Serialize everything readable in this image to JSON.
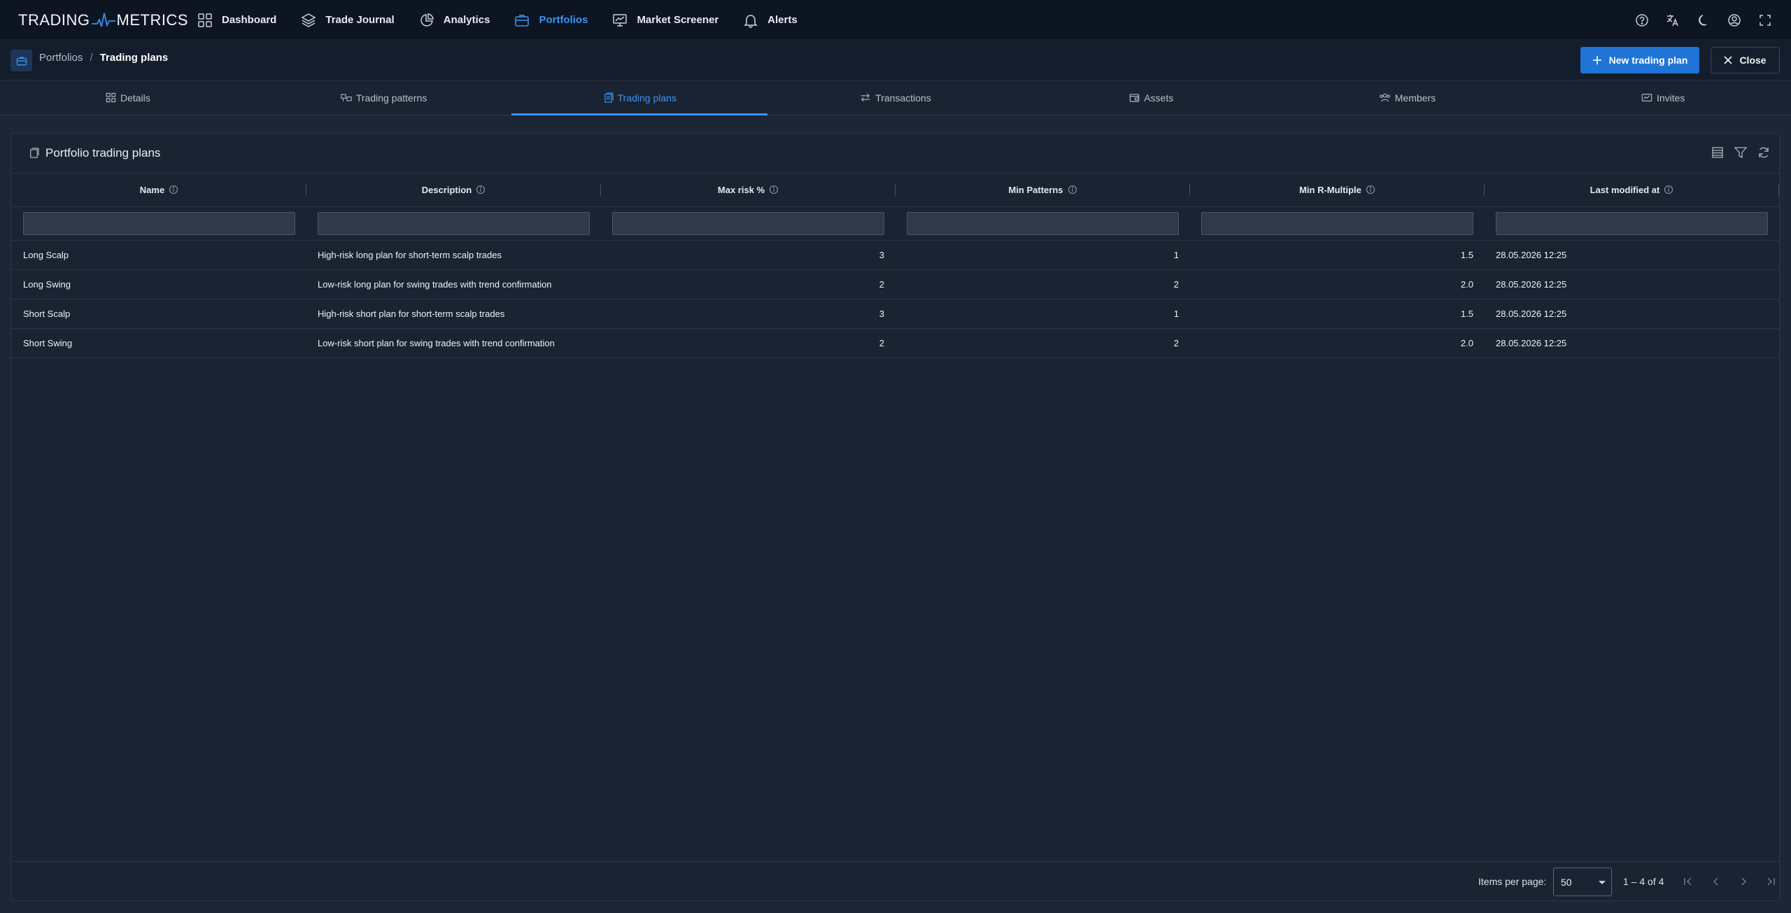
{
  "brand": {
    "left": "TRADING",
    "right": "METRICS"
  },
  "nav": {
    "items": [
      {
        "label": "Dashboard",
        "icon": "grid-icon"
      },
      {
        "label": "Trade Journal",
        "icon": "layers-icon"
      },
      {
        "label": "Analytics",
        "icon": "pie-chart-icon"
      },
      {
        "label": "Portfolios",
        "icon": "briefcase-icon"
      },
      {
        "label": "Market Screener",
        "icon": "monitor-chart-icon"
      },
      {
        "label": "Alerts",
        "icon": "bell-icon"
      }
    ],
    "active": "Portfolios",
    "right_icons": [
      "help-icon",
      "translate-icon",
      "dark-mode-icon",
      "account-icon",
      "fullscreen-icon"
    ]
  },
  "breadcrumb": {
    "parent": "Portfolios",
    "separator": "/",
    "current": "Trading plans"
  },
  "actions": {
    "new_label": "New trading plan",
    "close_label": "Close"
  },
  "tabs": [
    {
      "label": "Details",
      "icon": "details-icon"
    },
    {
      "label": "Trading patterns",
      "icon": "patterns-icon"
    },
    {
      "label": "Trading plans",
      "icon": "plans-icon"
    },
    {
      "label": "Transactions",
      "icon": "transfer-icon"
    },
    {
      "label": "Assets",
      "icon": "wallet-icon"
    },
    {
      "label": "Members",
      "icon": "users-icon"
    },
    {
      "label": "Invites",
      "icon": "invite-icon"
    }
  ],
  "active_tab": "Trading plans",
  "card": {
    "title": "Portfolio trading plans",
    "tools": [
      "column-settings-icon",
      "filter-icon",
      "refresh-icon"
    ]
  },
  "table": {
    "columns": [
      "Name",
      "Description",
      "Max risk %",
      "Min Patterns",
      "Min R-Multiple",
      "Last modified at"
    ],
    "rows": [
      {
        "name": "Long Scalp",
        "description": "High-risk long plan for short-term scalp trades",
        "max_risk": "3",
        "min_patterns": "1",
        "min_r": "1.5",
        "modified": "28.05.2026 12:25"
      },
      {
        "name": "Long Swing",
        "description": "Low-risk long plan for swing trades with trend confirmation",
        "max_risk": "2",
        "min_patterns": "2",
        "min_r": "2.0",
        "modified": "28.05.2026 12:25"
      },
      {
        "name": "Short Scalp",
        "description": "High-risk short plan for short-term scalp trades",
        "max_risk": "3",
        "min_patterns": "1",
        "min_r": "1.5",
        "modified": "28.05.2026 12:25"
      },
      {
        "name": "Short Swing",
        "description": "Low-risk short plan for swing trades with trend confirmation",
        "max_risk": "2",
        "min_patterns": "2",
        "min_r": "2.0",
        "modified": "28.05.2026 12:25"
      }
    ]
  },
  "paginator": {
    "items_label": "Items per page:",
    "page_size": "50",
    "range": "1 – 4 of 4"
  },
  "colors": {
    "accent": "#3b93f2",
    "primary_button": "#1f74d6",
    "background": "#1d2635",
    "topbar": "#0d1523"
  }
}
